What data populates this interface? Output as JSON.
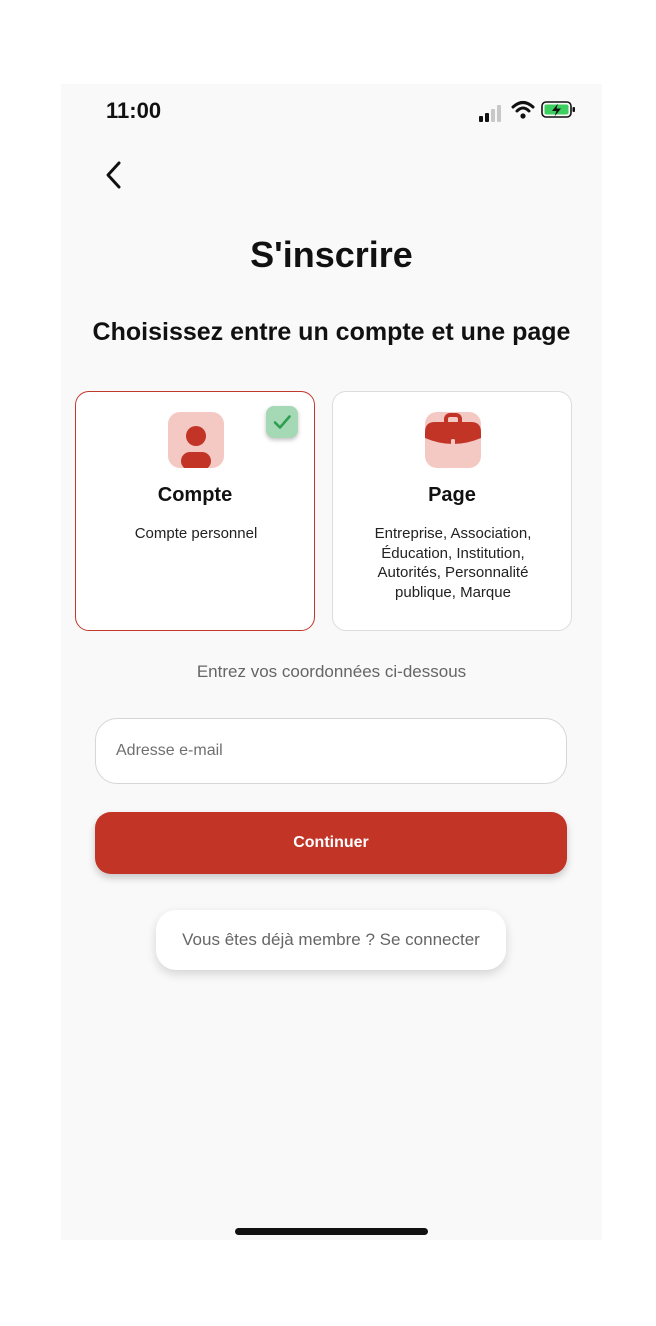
{
  "status_bar": {
    "time": "11:00"
  },
  "header": {
    "title": "S'inscrire"
  },
  "main": {
    "subtitle": "Choisissez entre un compte et une page",
    "cards": [
      {
        "title": "Compte",
        "description": "Compte personnel",
        "icon": "person-icon",
        "selected": true
      },
      {
        "title": "Page",
        "description": "Entreprise, Association, Éducation, Institution, Autorités, Personnalité publique, Marque",
        "icon": "briefcase-icon",
        "selected": false
      }
    ],
    "hint": "Entrez vos coordonnées ci-dessous",
    "email": {
      "placeholder": "Adresse e-mail",
      "value": ""
    },
    "continue_label": "Continuer",
    "login_label": "Vous êtes déjà membre ? Se connecter"
  },
  "colors": {
    "accent": "#c13426",
    "icon_background": "#f4c9c3",
    "check_background": "#a5d8b4",
    "check_mark": "#2e9e4f"
  }
}
